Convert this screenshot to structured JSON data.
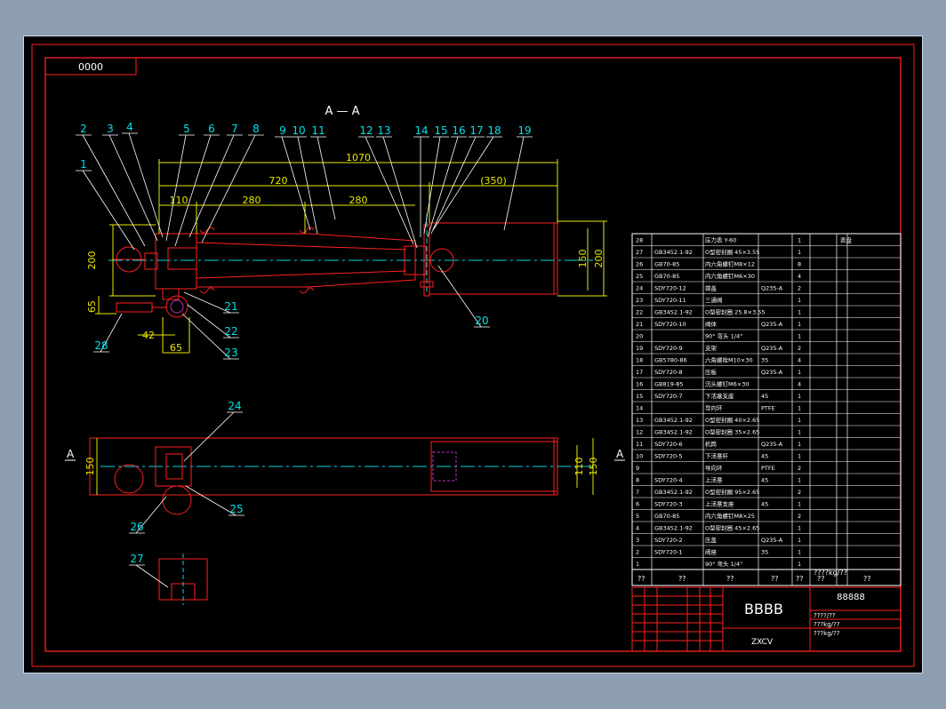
{
  "drawing": {
    "code_box": "0000",
    "section_title": "A — A",
    "section_mark": "A",
    "title_block": {
      "name": "BBBB",
      "code": "88888",
      "company": "ZXCV",
      "q2": "??",
      "unit_label": "????kg/??",
      "row_a": "????/??",
      "row_b": "???kg/??",
      "row_c": "???kg/??"
    }
  },
  "dimensions": {
    "total_len": "1070",
    "len_720": "720",
    "len_350": "(350)",
    "len_110": "110",
    "len_280a": "280",
    "len_280b": "280",
    "height_200_left": "200",
    "height_200_right": "200",
    "dia_150": "150",
    "height_65": "65",
    "offset_42": "42",
    "width_65": "65",
    "width_150": "150",
    "dia_110": "110",
    "dia_150_b": "150"
  },
  "balloons": [
    "1",
    "2",
    "3",
    "4",
    "5",
    "6",
    "7",
    "8",
    "9",
    "10",
    "11",
    "12",
    "13",
    "14",
    "15",
    "16",
    "17",
    "18",
    "19",
    "20",
    "21",
    "22",
    "23",
    "24",
    "25",
    "26",
    "27",
    "28"
  ],
  "bom_header": [
    "??",
    "??",
    "??",
    "??",
    "??",
    "??",
    "??"
  ],
  "bom": [
    {
      "no": "28",
      "code": "",
      "name": "压力表 Y-60",
      "mat": "",
      "qty": "1",
      "note": "表盘"
    },
    {
      "no": "27",
      "code": "GB3452.1-92",
      "name": "O型密封圈 45×3.55",
      "mat": "",
      "qty": "1",
      "note": ""
    },
    {
      "no": "26",
      "code": "GB70-85",
      "name": "内六角螺钉M8×12",
      "mat": "",
      "qty": "8",
      "note": ""
    },
    {
      "no": "25",
      "code": "GB70-85",
      "name": "内六角螺钉M6×30",
      "mat": "",
      "qty": "4",
      "note": ""
    },
    {
      "no": "24",
      "code": "SDY720-12",
      "name": "端盖",
      "mat": "Q235-A",
      "qty": "2",
      "note": ""
    },
    {
      "no": "23",
      "code": "SDY720-11",
      "name": "三通阀",
      "mat": "",
      "qty": "1",
      "note": ""
    },
    {
      "no": "22",
      "code": "GB3452.1-92",
      "name": "O型密封圈 25.8×3.55",
      "mat": "",
      "qty": "1",
      "note": ""
    },
    {
      "no": "21",
      "code": "SDY720-10",
      "name": "阀体",
      "mat": "Q235-A",
      "qty": "1",
      "note": ""
    },
    {
      "no": "20",
      "code": "",
      "name": "90° 弯头 1/4\"",
      "mat": "",
      "qty": "1",
      "note": ""
    },
    {
      "no": "19",
      "code": "SDY720-9",
      "name": "支架",
      "mat": "Q235-A",
      "qty": "2",
      "note": ""
    },
    {
      "no": "18",
      "code": "GB5780-86",
      "name": "六角螺栓M10×30",
      "mat": "35",
      "qty": "4",
      "note": ""
    },
    {
      "no": "17",
      "code": "SDY720-8",
      "name": "压板",
      "mat": "Q235-A",
      "qty": "1",
      "note": ""
    },
    {
      "no": "16",
      "code": "GB819-85",
      "name": "沉头螺钉M6×30",
      "mat": "",
      "qty": "4",
      "note": ""
    },
    {
      "no": "15",
      "code": "SDY720-7",
      "name": "下活塞支座",
      "mat": "45",
      "qty": "1",
      "note": ""
    },
    {
      "no": "14",
      "code": "",
      "name": "导向环",
      "mat": "PTFE",
      "qty": "1",
      "note": ""
    },
    {
      "no": "13",
      "code": "GB3452.1-92",
      "name": "O型密封圈 40×2.65",
      "mat": "",
      "qty": "1",
      "note": ""
    },
    {
      "no": "12",
      "code": "GB3452.1-92",
      "name": "O型密封圈 35×2.65",
      "mat": "",
      "qty": "1",
      "note": ""
    },
    {
      "no": "11",
      "code": "SDY720-6",
      "name": "机筒",
      "mat": "Q235-A",
      "qty": "1",
      "note": ""
    },
    {
      "no": "10",
      "code": "SDY720-5",
      "name": "下活塞杆",
      "mat": "45",
      "qty": "1",
      "note": ""
    },
    {
      "no": "9",
      "code": "",
      "name": "导向环",
      "mat": "PTFE",
      "qty": "2",
      "note": ""
    },
    {
      "no": "8",
      "code": "SDY720-4",
      "name": "上活塞",
      "mat": "45",
      "qty": "1",
      "note": ""
    },
    {
      "no": "7",
      "code": "GB3452.1-92",
      "name": "O型密封圈 95×2.65",
      "mat": "",
      "qty": "2",
      "note": ""
    },
    {
      "no": "6",
      "code": "SDY720-3",
      "name": "上活塞支座",
      "mat": "45",
      "qty": "1",
      "note": ""
    },
    {
      "no": "5",
      "code": "GB70-85",
      "name": "内六角螺钉M8×25",
      "mat": "",
      "qty": "2",
      "note": ""
    },
    {
      "no": "4",
      "code": "GB3452.1-92",
      "name": "O型密封圈 45×2.65",
      "mat": "",
      "qty": "1",
      "note": ""
    },
    {
      "no": "3",
      "code": "SDY720-2",
      "name": "压盖",
      "mat": "Q235-A",
      "qty": "1",
      "note": ""
    },
    {
      "no": "2",
      "code": "SDY720-1",
      "name": "阀座",
      "mat": "35",
      "qty": "1",
      "note": ""
    },
    {
      "no": "1",
      "code": "",
      "name": "90° 弯头 1/4\"",
      "mat": "",
      "qty": "1",
      "note": ""
    }
  ]
}
